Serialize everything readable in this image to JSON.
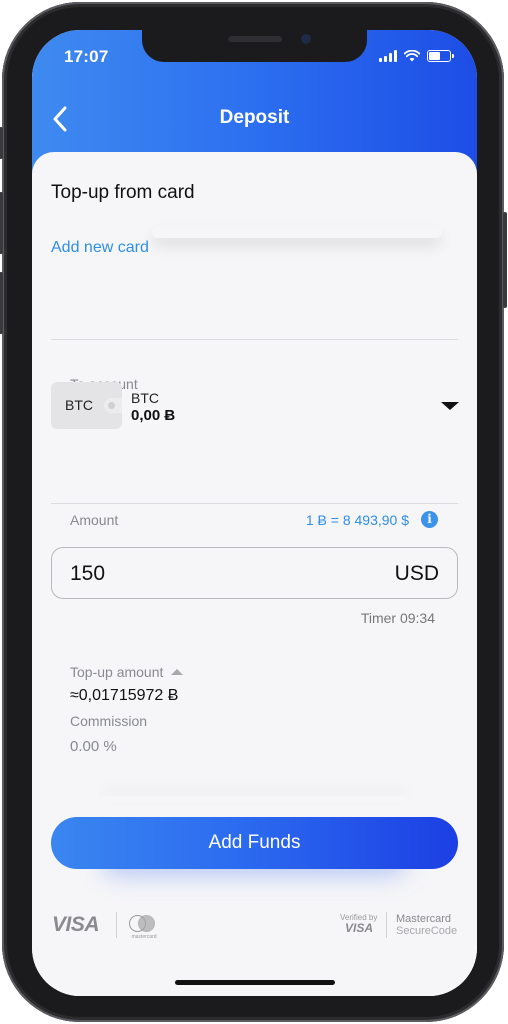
{
  "status_bar": {
    "time": "17:07"
  },
  "nav": {
    "title": "Deposit"
  },
  "topup_section": {
    "title": "Top-up from  card",
    "add_card_link": "Add new card"
  },
  "account": {
    "label": "To account",
    "wallet_code": "BTC",
    "name": "BTC",
    "balance": "0,00 Ƀ"
  },
  "amount": {
    "label": "Amount",
    "rate": "1 Ƀ = 8 493,90 $",
    "value": "150",
    "currency": "USD",
    "timer": "Timer 09:34"
  },
  "summary": {
    "topup_label": "Top-up amount",
    "topup_value": "≈0,01715972 Ƀ",
    "commission_label": "Commission",
    "commission_value": "0.00 %"
  },
  "actions": {
    "add_funds": "Add Funds"
  },
  "footer": {
    "visa": "VISA",
    "mastercard_small": "mastercard",
    "verified_by": "Verified by",
    "verified_visa": "VISA",
    "mc_securecode_1": "Mastercard",
    "mc_securecode_2": "SecureCode"
  },
  "colors": {
    "accent_blue": "#2f8ee6",
    "header_gradient_start": "#3f8af0",
    "header_gradient_end": "#1d4de6"
  }
}
